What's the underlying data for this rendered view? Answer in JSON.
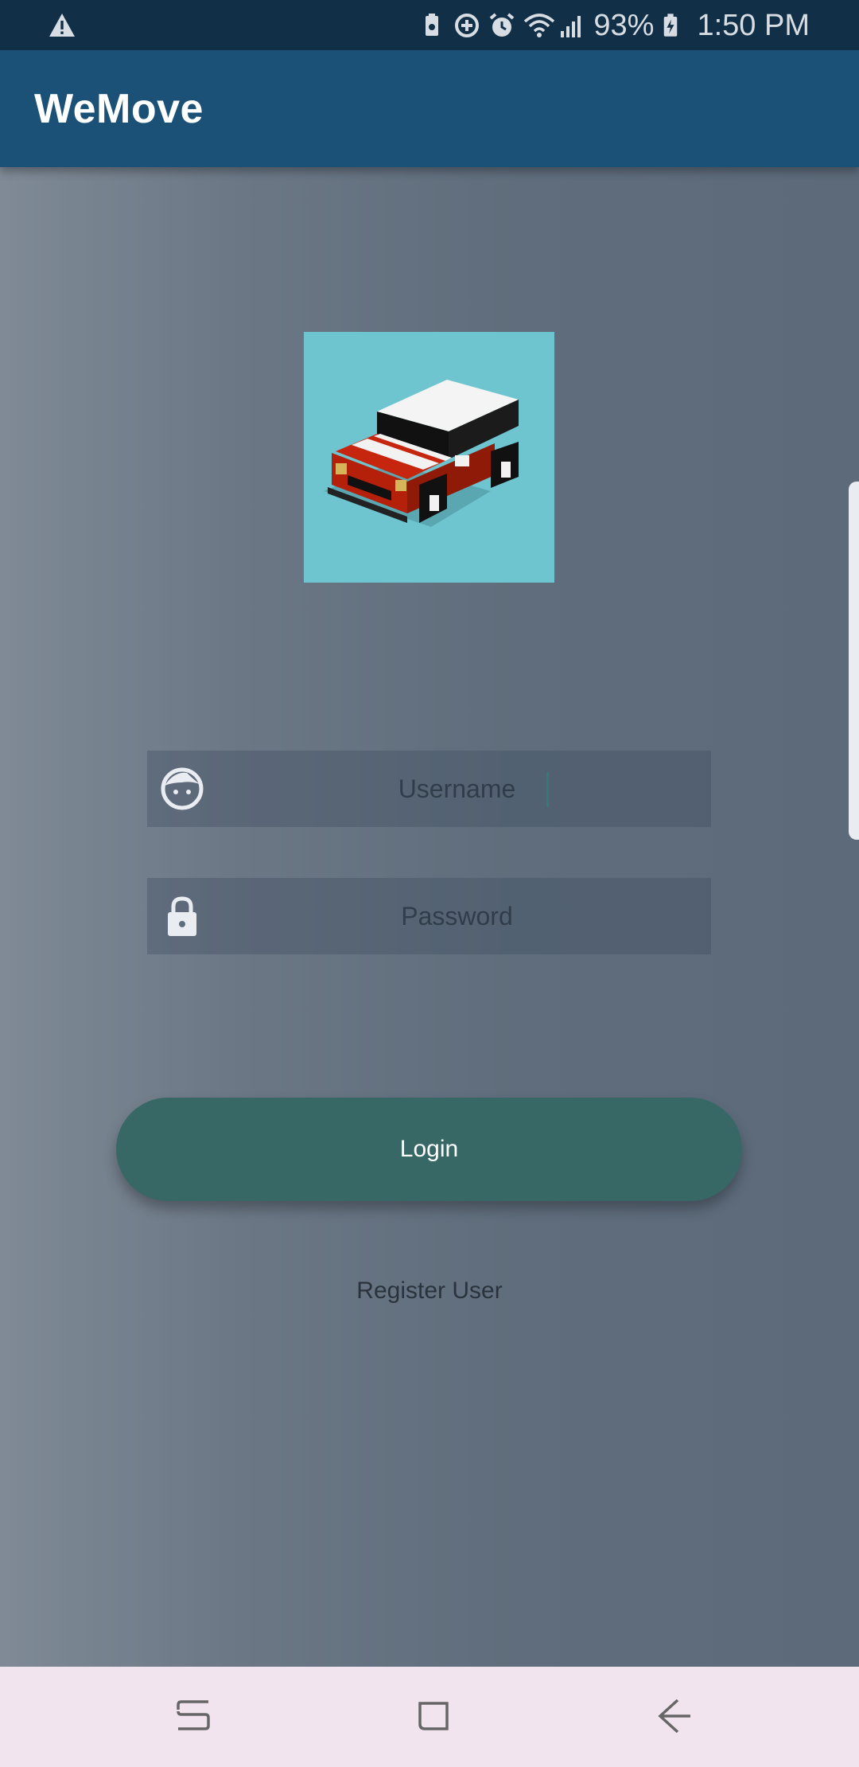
{
  "status_bar": {
    "battery": "93%",
    "time": "1:50 PM",
    "icons": [
      "warning-icon",
      "battery-saver-icon",
      "data-saver-icon",
      "alarm-icon",
      "wifi-icon",
      "signal-icon",
      "battery-charging-icon"
    ]
  },
  "app_bar": {
    "title": "WeMove"
  },
  "logo": {
    "icon": "car-logo-icon",
    "background": "#6ec5d0"
  },
  "login_form": {
    "username": {
      "placeholder": "Username",
      "value": "",
      "icon": "face-icon"
    },
    "password": {
      "placeholder": "Password",
      "value": "",
      "icon": "lock-icon"
    },
    "login_label": "Login",
    "register_label": "Register User"
  },
  "nav_bar": {
    "buttons": [
      "recents-icon",
      "home-icon",
      "back-icon"
    ]
  },
  "colors": {
    "status_bar": "#112f46",
    "app_bar": "#1b5176",
    "login_button": "#386866",
    "nav_bar": "#f1e4ef"
  }
}
